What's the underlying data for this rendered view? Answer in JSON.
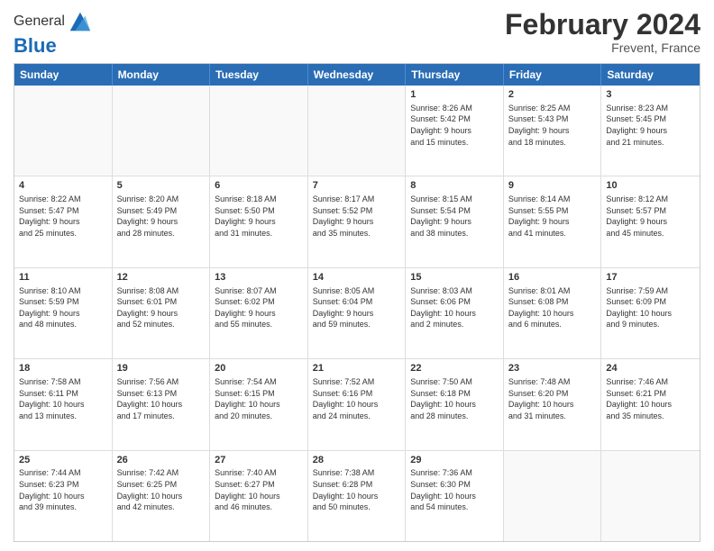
{
  "logo": {
    "general": "General",
    "blue": "Blue"
  },
  "title": "February 2024",
  "subtitle": "Frevent, France",
  "days": [
    "Sunday",
    "Monday",
    "Tuesday",
    "Wednesday",
    "Thursday",
    "Friday",
    "Saturday"
  ],
  "rows": [
    [
      {
        "day": "",
        "text": ""
      },
      {
        "day": "",
        "text": ""
      },
      {
        "day": "",
        "text": ""
      },
      {
        "day": "",
        "text": ""
      },
      {
        "day": "1",
        "text": "Sunrise: 8:26 AM\nSunset: 5:42 PM\nDaylight: 9 hours\nand 15 minutes."
      },
      {
        "day": "2",
        "text": "Sunrise: 8:25 AM\nSunset: 5:43 PM\nDaylight: 9 hours\nand 18 minutes."
      },
      {
        "day": "3",
        "text": "Sunrise: 8:23 AM\nSunset: 5:45 PM\nDaylight: 9 hours\nand 21 minutes."
      }
    ],
    [
      {
        "day": "4",
        "text": "Sunrise: 8:22 AM\nSunset: 5:47 PM\nDaylight: 9 hours\nand 25 minutes."
      },
      {
        "day": "5",
        "text": "Sunrise: 8:20 AM\nSunset: 5:49 PM\nDaylight: 9 hours\nand 28 minutes."
      },
      {
        "day": "6",
        "text": "Sunrise: 8:18 AM\nSunset: 5:50 PM\nDaylight: 9 hours\nand 31 minutes."
      },
      {
        "day": "7",
        "text": "Sunrise: 8:17 AM\nSunset: 5:52 PM\nDaylight: 9 hours\nand 35 minutes."
      },
      {
        "day": "8",
        "text": "Sunrise: 8:15 AM\nSunset: 5:54 PM\nDaylight: 9 hours\nand 38 minutes."
      },
      {
        "day": "9",
        "text": "Sunrise: 8:14 AM\nSunset: 5:55 PM\nDaylight: 9 hours\nand 41 minutes."
      },
      {
        "day": "10",
        "text": "Sunrise: 8:12 AM\nSunset: 5:57 PM\nDaylight: 9 hours\nand 45 minutes."
      }
    ],
    [
      {
        "day": "11",
        "text": "Sunrise: 8:10 AM\nSunset: 5:59 PM\nDaylight: 9 hours\nand 48 minutes."
      },
      {
        "day": "12",
        "text": "Sunrise: 8:08 AM\nSunset: 6:01 PM\nDaylight: 9 hours\nand 52 minutes."
      },
      {
        "day": "13",
        "text": "Sunrise: 8:07 AM\nSunset: 6:02 PM\nDaylight: 9 hours\nand 55 minutes."
      },
      {
        "day": "14",
        "text": "Sunrise: 8:05 AM\nSunset: 6:04 PM\nDaylight: 9 hours\nand 59 minutes."
      },
      {
        "day": "15",
        "text": "Sunrise: 8:03 AM\nSunset: 6:06 PM\nDaylight: 10 hours\nand 2 minutes."
      },
      {
        "day": "16",
        "text": "Sunrise: 8:01 AM\nSunset: 6:08 PM\nDaylight: 10 hours\nand 6 minutes."
      },
      {
        "day": "17",
        "text": "Sunrise: 7:59 AM\nSunset: 6:09 PM\nDaylight: 10 hours\nand 9 minutes."
      }
    ],
    [
      {
        "day": "18",
        "text": "Sunrise: 7:58 AM\nSunset: 6:11 PM\nDaylight: 10 hours\nand 13 minutes."
      },
      {
        "day": "19",
        "text": "Sunrise: 7:56 AM\nSunset: 6:13 PM\nDaylight: 10 hours\nand 17 minutes."
      },
      {
        "day": "20",
        "text": "Sunrise: 7:54 AM\nSunset: 6:15 PM\nDaylight: 10 hours\nand 20 minutes."
      },
      {
        "day": "21",
        "text": "Sunrise: 7:52 AM\nSunset: 6:16 PM\nDaylight: 10 hours\nand 24 minutes."
      },
      {
        "day": "22",
        "text": "Sunrise: 7:50 AM\nSunset: 6:18 PM\nDaylight: 10 hours\nand 28 minutes."
      },
      {
        "day": "23",
        "text": "Sunrise: 7:48 AM\nSunset: 6:20 PM\nDaylight: 10 hours\nand 31 minutes."
      },
      {
        "day": "24",
        "text": "Sunrise: 7:46 AM\nSunset: 6:21 PM\nDaylight: 10 hours\nand 35 minutes."
      }
    ],
    [
      {
        "day": "25",
        "text": "Sunrise: 7:44 AM\nSunset: 6:23 PM\nDaylight: 10 hours\nand 39 minutes."
      },
      {
        "day": "26",
        "text": "Sunrise: 7:42 AM\nSunset: 6:25 PM\nDaylight: 10 hours\nand 42 minutes."
      },
      {
        "day": "27",
        "text": "Sunrise: 7:40 AM\nSunset: 6:27 PM\nDaylight: 10 hours\nand 46 minutes."
      },
      {
        "day": "28",
        "text": "Sunrise: 7:38 AM\nSunset: 6:28 PM\nDaylight: 10 hours\nand 50 minutes."
      },
      {
        "day": "29",
        "text": "Sunrise: 7:36 AM\nSunset: 6:30 PM\nDaylight: 10 hours\nand 54 minutes."
      },
      {
        "day": "",
        "text": ""
      },
      {
        "day": "",
        "text": ""
      }
    ]
  ]
}
